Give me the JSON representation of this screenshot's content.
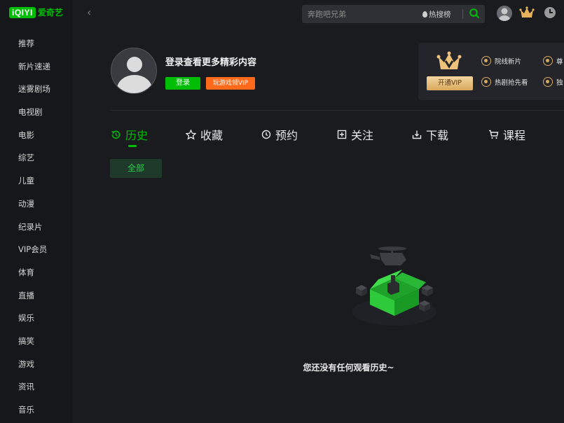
{
  "brand": {
    "logo_mark": "iQIYI",
    "logo_text": "爱奇艺"
  },
  "sidebar": {
    "items": [
      {
        "label": "推荐"
      },
      {
        "label": "新片速递"
      },
      {
        "label": "迷雾剧场"
      },
      {
        "label": "电视剧"
      },
      {
        "label": "电影"
      },
      {
        "label": "综艺"
      },
      {
        "label": "儿童"
      },
      {
        "label": "动漫"
      },
      {
        "label": "纪录片"
      },
      {
        "label": "VIP会员"
      },
      {
        "label": "体育"
      },
      {
        "label": "直播"
      },
      {
        "label": "娱乐"
      },
      {
        "label": "搞笑"
      },
      {
        "label": "游戏"
      },
      {
        "label": "资讯"
      },
      {
        "label": "音乐"
      }
    ]
  },
  "search": {
    "placeholder": "奔跑吧兄弟",
    "hot_label": "热搜榜"
  },
  "profile": {
    "login_tip": "登录查看更多精彩内容",
    "login_button": "登录",
    "game_button": "玩游戏领VIP"
  },
  "vip": {
    "open_button": "开通VIP",
    "perks": [
      {
        "label": "院线新片"
      },
      {
        "label": "热剧抢先看"
      },
      {
        "label": "尊"
      },
      {
        "label": "独"
      }
    ]
  },
  "tabs": [
    {
      "label": "历史",
      "icon": "history-icon",
      "active": true
    },
    {
      "label": "收藏",
      "icon": "star-icon"
    },
    {
      "label": "预约",
      "icon": "clock-icon"
    },
    {
      "label": "关注",
      "icon": "follow-icon"
    },
    {
      "label": "下载",
      "icon": "download-icon"
    },
    {
      "label": "课程",
      "icon": "cart-icon"
    }
  ],
  "filter": {
    "all_label": "全部"
  },
  "empty_state": {
    "message": "您还没有任何观看历史~"
  },
  "colors": {
    "accent": "#00be06",
    "orange": "#ff6a1a",
    "gold": "#d9a95d",
    "bg": "#1a1b1f"
  }
}
